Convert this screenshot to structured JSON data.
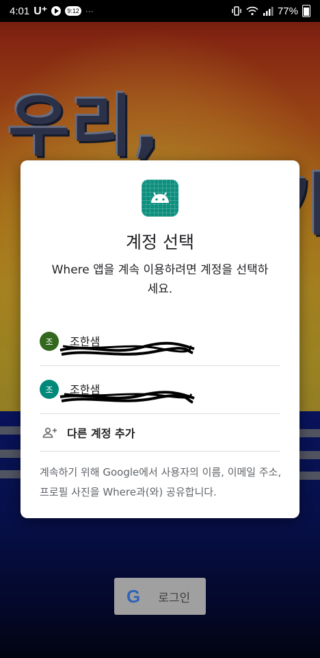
{
  "status_bar": {
    "time": "4:01",
    "carrier": "U⁺",
    "badge": "9:12",
    "more": "···",
    "battery": "77%"
  },
  "background": {
    "headline_left": "우리,",
    "headline_right": "가",
    "login_button": {
      "logo": "G",
      "label": "로그인"
    }
  },
  "dialog": {
    "icon": "android-app-icon",
    "title": "계정 선택",
    "subtitle": "Where 앱을 계속 이용하려면 계정을 선택하세요.",
    "accounts": [
      {
        "initial": "조",
        "name": "조한샘",
        "email": "",
        "avatar_color": "#33691e"
      },
      {
        "initial": "조",
        "name": "조한샘",
        "email": "",
        "avatar_color": "#00897b"
      }
    ],
    "add_account_label": "다른 계정 추가",
    "footer": "계속하기 위해 Google에서 사용자의 이름, 이메일 주소, 프로필 사진을 Where과(와) 공유합니다."
  }
}
